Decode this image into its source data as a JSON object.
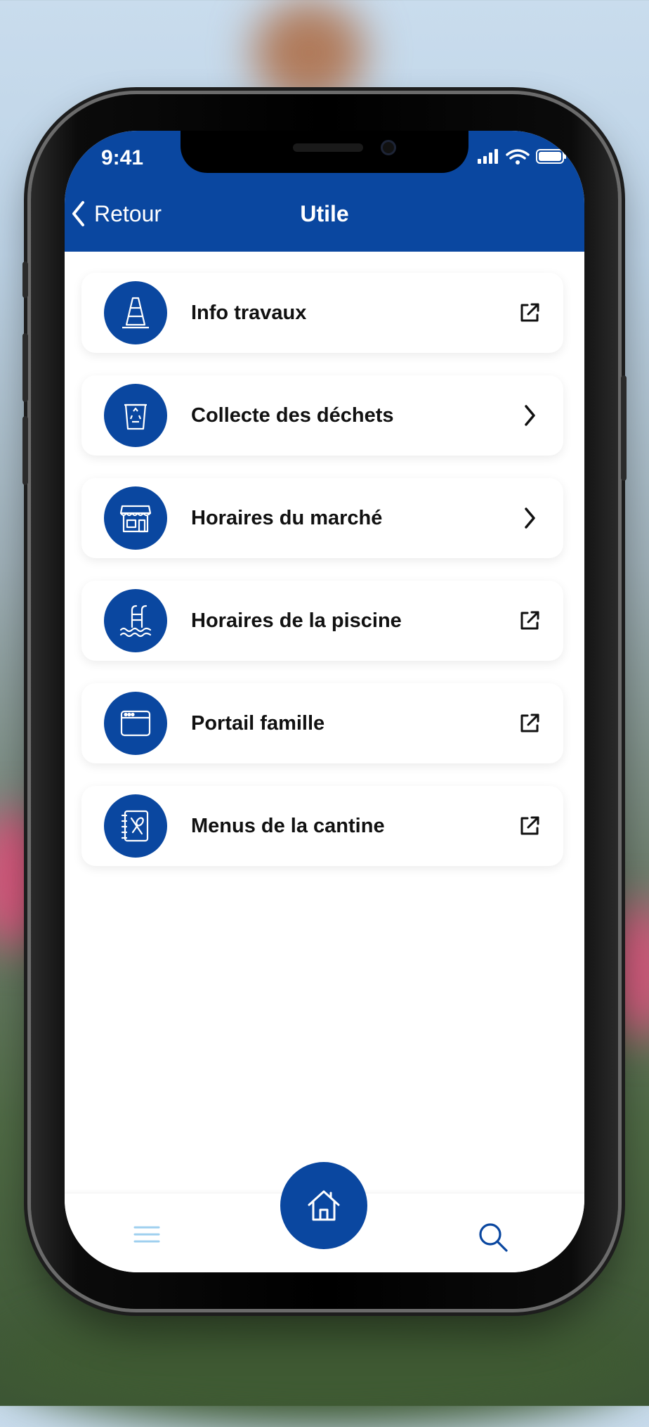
{
  "status": {
    "time": "9:41"
  },
  "header": {
    "back_label": "Retour",
    "title": "Utile"
  },
  "items": [
    {
      "label": "Info travaux",
      "icon": "traffic-cone-icon",
      "trail_icon": "external-link-icon"
    },
    {
      "label": "Collecte des déchets",
      "icon": "recycle-bin-icon",
      "trail_icon": "chevron-right-icon"
    },
    {
      "label": "Horaires du marché",
      "icon": "market-stall-icon",
      "trail_icon": "chevron-right-icon"
    },
    {
      "label": "Horaires de la piscine",
      "icon": "pool-ladder-icon",
      "trail_icon": "external-link-icon"
    },
    {
      "label": "Portail famille",
      "icon": "browser-window-icon",
      "trail_icon": "external-link-icon"
    },
    {
      "label": "Menus de la cantine",
      "icon": "menu-book-icon",
      "trail_icon": "external-link-icon"
    }
  ],
  "tabbar": {
    "left_icon": "hamburger-menu-icon",
    "center_icon": "home-icon",
    "right_icon": "search-icon"
  },
  "colors": {
    "primary": "#0a47a0",
    "background": "#ffffff",
    "text": "#111111",
    "menu_icon": "#9fd0ef"
  }
}
